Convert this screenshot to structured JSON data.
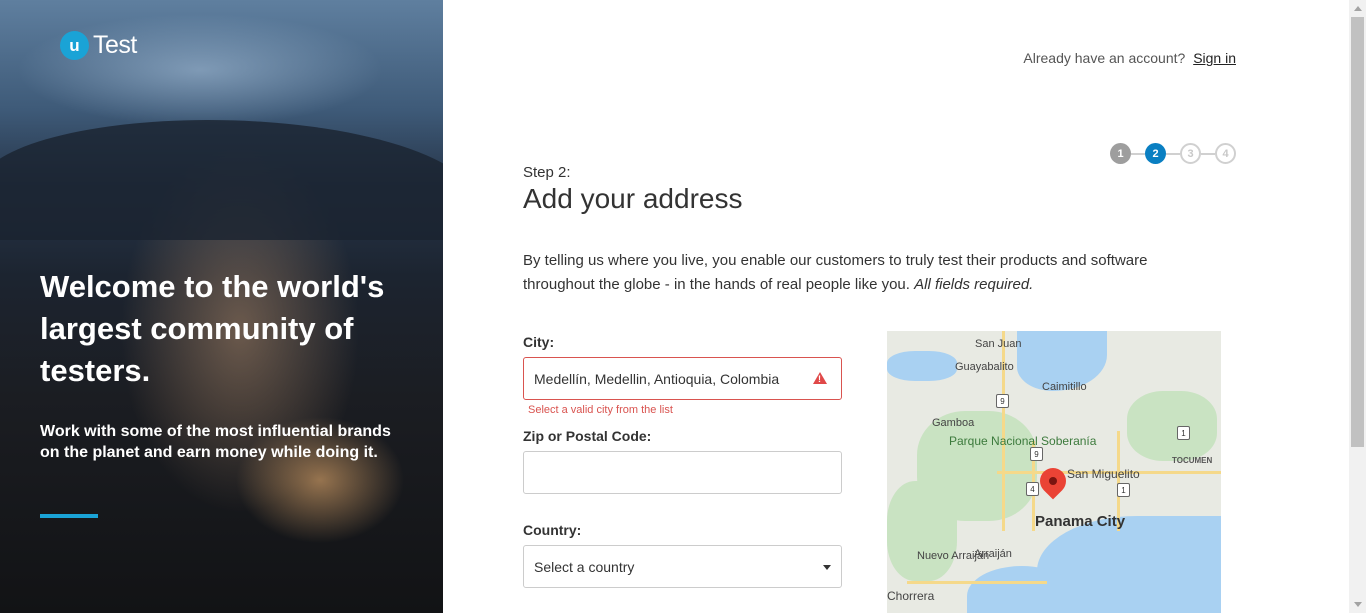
{
  "brand": {
    "logo_letter": "u",
    "logo_text": "Test"
  },
  "hero": {
    "headline": "Welcome to the world's largest community of testers.",
    "subtext": "Work with some of the most influential brands on the planet and earn money while doing it."
  },
  "topbar": {
    "prompt": "Already have an account?",
    "signin_label": "Sign in"
  },
  "stepper": {
    "steps": [
      "1",
      "2",
      "3",
      "4"
    ],
    "current": 2
  },
  "form": {
    "step_label": "Step 2:",
    "title": "Add your address",
    "intro": "By telling us where you live, you enable our customers to truly test their products and software throughout the globe - in the hands of real people like you.",
    "intro_emphasis": "All fields required.",
    "city": {
      "label": "City:",
      "value": "Medellín, Medellin, Antioquia, Colombia",
      "error": "Select a valid city from the list"
    },
    "zip": {
      "label": "Zip or Postal Code:",
      "value": ""
    },
    "country": {
      "label": "Country:",
      "selected": "Select a country"
    }
  },
  "map": {
    "labels": {
      "san_juan": "San Juan",
      "guayabalito": "Guayabalito",
      "caimitillo": "Caimitillo",
      "gamboa": "Gamboa",
      "park": "Parque Nacional Soberanía",
      "san_miguelito": "San Miguelito",
      "tocumen": "TOCUMEN",
      "panama_city": "Panama City",
      "nuevo_arraijan": "Nuevo Arraiján",
      "arraijan": "Arraiján",
      "chorrera": "Chorrera"
    },
    "shields": [
      "9",
      "9",
      "4",
      "1",
      "1"
    ],
    "colors": {
      "water": "#a9d1f2",
      "land": "#e8eae3",
      "park": "#c9e3c2",
      "pin": "#ea4335"
    }
  },
  "colors": {
    "accent": "#1aa3d6",
    "step_active": "#0a7fc2",
    "error": "#d9534f"
  }
}
